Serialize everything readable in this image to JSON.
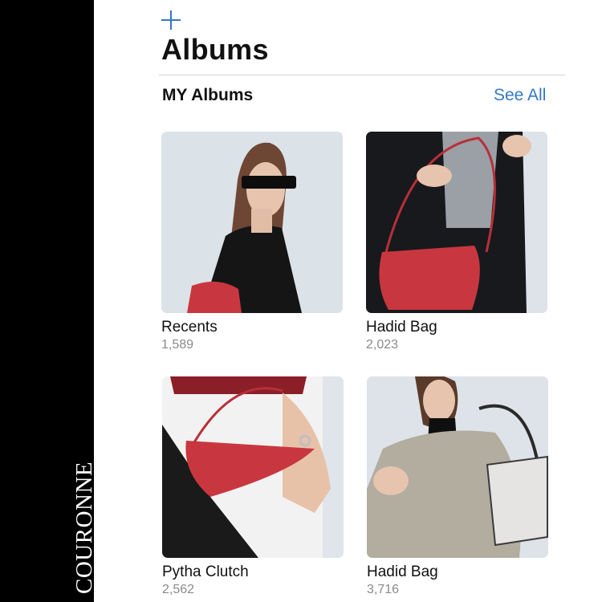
{
  "brand": {
    "name": "COURONNE"
  },
  "header": {
    "add_icon": "plus-icon",
    "title": "Albums"
  },
  "section": {
    "title": "MY Albums",
    "see_all_label": "See All"
  },
  "albums": [
    {
      "name": "Recents",
      "count": "1,589"
    },
    {
      "name": "Hadid Bag",
      "count": "2,023"
    },
    {
      "name": "Pytha Clutch",
      "count": "2,562"
    },
    {
      "name": "Hadid Bag",
      "count": "3,716"
    }
  ],
  "colors": {
    "accent": "#3478c8",
    "sidebar": "#000000",
    "count_text": "#8a8a8a",
    "bag_red": "#c8373f"
  }
}
